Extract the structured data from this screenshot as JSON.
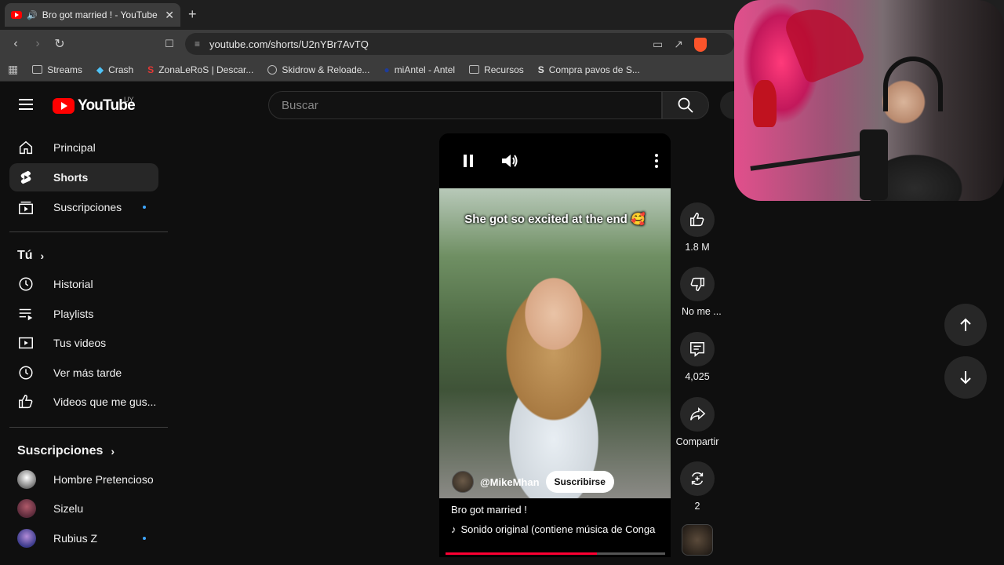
{
  "browser": {
    "tab_title": "Bro got married ! - YouTube",
    "url": "youtube.com/shorts/U2nYBr7AvTQ",
    "bookmarks": [
      {
        "label": "Streams",
        "icon": "folder-icon"
      },
      {
        "label": "Crash",
        "icon": "droplet-icon"
      },
      {
        "label": "ZonaLeRoS | Descar...",
        "icon": "zonaleros-icon"
      },
      {
        "label": "Skidrow & Reloade...",
        "icon": "globe-icon"
      },
      {
        "label": "miAntel - Antel",
        "icon": "antel-icon"
      },
      {
        "label": "Recursos",
        "icon": "folder-icon"
      },
      {
        "label": "Compra pavos de S...",
        "icon": "s-icon"
      }
    ]
  },
  "youtube": {
    "logo_text": "YouTube",
    "country_code": "UY",
    "search_placeholder": "Buscar"
  },
  "sidebar": {
    "main_items": [
      {
        "label": "Principal",
        "icon": "home-icon"
      },
      {
        "label": "Shorts",
        "icon": "shorts-icon",
        "active": true
      },
      {
        "label": "Suscripciones",
        "icon": "subscriptions-icon",
        "dot": true
      }
    ],
    "you_header": "Tú",
    "you_items": [
      {
        "label": "Historial",
        "icon": "history-icon"
      },
      {
        "label": "Playlists",
        "icon": "playlists-icon"
      },
      {
        "label": "Tus videos",
        "icon": "your-videos-icon"
      },
      {
        "label": "Ver más tarde",
        "icon": "watch-later-icon"
      },
      {
        "label": "Videos que me gus...",
        "icon": "liked-icon"
      }
    ],
    "subs_header": "Suscripciones",
    "subs_items": [
      {
        "label": "Hombre Pretencioso",
        "avatar_color": "#e8e8e8"
      },
      {
        "label": "Sizelu",
        "avatar_color": "#5a2a3a"
      },
      {
        "label": "Rubius Z",
        "avatar_color": "#3a3a8a",
        "dot": true
      }
    ]
  },
  "short": {
    "caption": "She got so excited at the end 🥰",
    "channel": "@MikeMhan",
    "subscribe_label": "Suscribirse",
    "title": "Bro got married !",
    "sound": "Sonido original (contiene música de Conga",
    "progress": 0.69
  },
  "actions": {
    "likes": "1.8 M",
    "dislike": "No me ...",
    "comments": "4,025",
    "share": "Compartir",
    "remix": "2"
  },
  "colors": {
    "accent_red": "#ff0000",
    "progress_red": "#ff0033",
    "background": "#0f0f0f",
    "dot_blue": "#3ea6ff"
  }
}
